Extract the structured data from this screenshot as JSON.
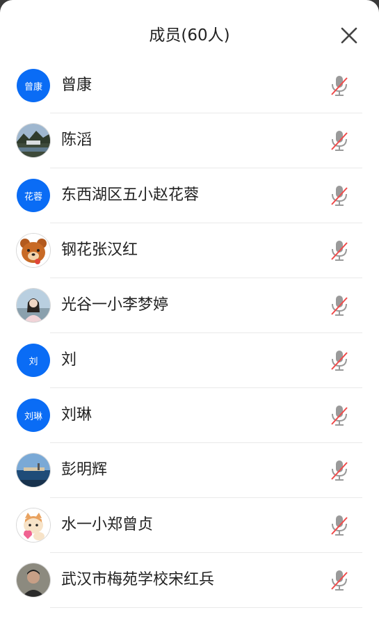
{
  "header": {
    "title": "成员(60人)"
  },
  "members": [
    {
      "name": "曾康",
      "avatar_text": "曾康",
      "avatar_type": "text",
      "status_icon": "mic-muted-icon"
    },
    {
      "name": "陈滔",
      "avatar_type": "photo",
      "photo_icon": "landscape-photo",
      "status_icon": "mic-muted-icon"
    },
    {
      "name": "东西湖区五小赵花蓉",
      "avatar_text": "花蓉",
      "avatar_type": "text",
      "status_icon": "mic-muted-icon"
    },
    {
      "name": "钢花张汉红",
      "avatar_type": "photo",
      "photo_icon": "bear-cartoon",
      "status_icon": "mic-muted-icon"
    },
    {
      "name": "光谷一小李梦婷",
      "avatar_type": "photo",
      "photo_icon": "person-photo",
      "status_icon": "mic-muted-icon"
    },
    {
      "name": "刘",
      "avatar_text": "刘",
      "avatar_type": "text",
      "status_icon": "mic-muted-icon"
    },
    {
      "name": "刘琳",
      "avatar_text": "刘琳",
      "avatar_type": "text",
      "status_icon": "mic-muted-icon"
    },
    {
      "name": "彭明辉",
      "avatar_type": "photo",
      "photo_icon": "seaside-photo",
      "status_icon": "mic-muted-icon"
    },
    {
      "name": "水一小郑曾贞",
      "avatar_type": "photo",
      "photo_icon": "cat-cartoon",
      "status_icon": "mic-muted-icon"
    },
    {
      "name": "武汉市梅苑学校宋红兵",
      "avatar_type": "photo",
      "photo_icon": "man-portrait",
      "status_icon": "mic-muted-icon"
    }
  ],
  "colors": {
    "avatar_blue": "#0a6cf5",
    "mic_gray": "#9a9a9a",
    "mute_red": "#f04a4a"
  }
}
